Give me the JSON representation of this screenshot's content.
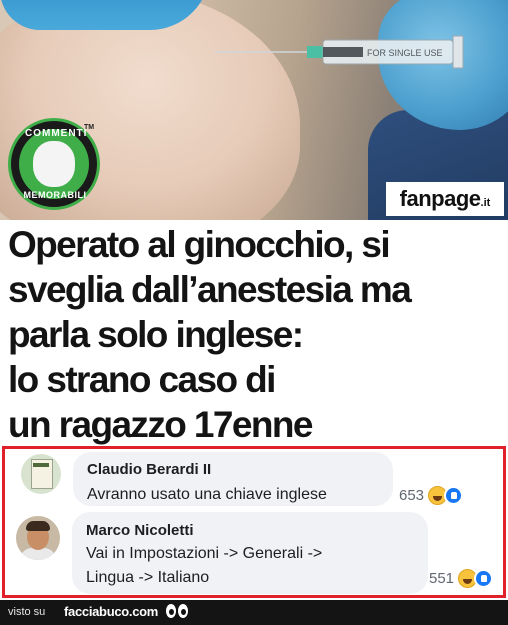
{
  "image": {
    "badge_top_text": "COMMENTI",
    "badge_bottom_text": "MEMORABILI",
    "badge_tm": "TM",
    "syringe_text": "FOR SINGLE USE",
    "brand_main": "fanpage",
    "brand_tld": ".it"
  },
  "headline": [
    "Operato al ginocchio, si",
    "sveglia dall’anestesia ma",
    "parla solo inglese:",
    "lo strano caso di",
    "un ragazzo 17enne"
  ],
  "comments": [
    {
      "author": "Claudio Berardi II",
      "lines": [
        "Avranno usato una chiave inglese"
      ],
      "reaction_count": "653",
      "reactions": [
        "haha-icon",
        "like-icon"
      ]
    },
    {
      "author": "Marco Nicoletti",
      "lines": [
        "Vai in Impostazioni -> Generali ->",
        "Lingua -> Italiano"
      ],
      "reaction_count": "551",
      "reactions": [
        "haha-icon",
        "like-icon"
      ]
    }
  ],
  "footer": {
    "seen_on": "visto su",
    "site": "facciabuco.com"
  },
  "colors": {
    "frame_red": "#e0202b",
    "bubble_gray": "#f0f2f5",
    "badge_green": "#3fae49",
    "like_blue": "#1877f2"
  }
}
